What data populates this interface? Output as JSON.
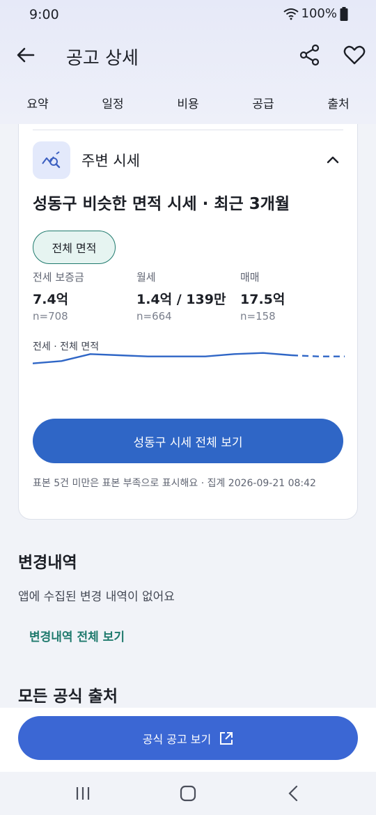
{
  "status_bar": {
    "time": "9:00",
    "battery": "100%"
  },
  "header": {
    "title": "공고 상세"
  },
  "tabs": [
    {
      "label": "요약"
    },
    {
      "label": "일정"
    },
    {
      "label": "비용"
    },
    {
      "label": "공급"
    },
    {
      "label": "출처"
    }
  ],
  "market_card": {
    "heading": "주변 시세",
    "subtitle": "성동구 비슷한 면적 시세 · 최근 3개월",
    "filter_chip": "전체 면적",
    "stats": [
      {
        "label": "전세 보증금",
        "value": "7.4억",
        "n": "n=708"
      },
      {
        "label": "월세",
        "value": "1.4억 / 139만",
        "n": "n=664"
      },
      {
        "label": "매매",
        "value": "17.5억",
        "n": "n=158"
      }
    ],
    "chart_label": "전세 · 전체 면적",
    "view_all_button": "성동구 시세 전체 보기",
    "footnote": "표본 5건 미만은 표본 부족으로 표시해요 · 집계 2026-09-21 08:42",
    "colors": {
      "accent": "#2f66c6",
      "chip_border": "#1f7a6d"
    }
  },
  "chart_data": {
    "type": "line",
    "title": "전세 · 전체 면적",
    "series": [
      {
        "values": [
          0.2,
          0.4,
          1.0,
          0.9,
          0.8,
          0.8,
          0.8,
          1.0,
          1.1,
          0.9
        ],
        "style": "solid"
      },
      {
        "values": [
          0.9,
          0.8,
          0.8
        ],
        "style": "dashed"
      }
    ]
  },
  "changes": {
    "title": "변경내역",
    "empty_text": "앱에 수집된 변경 내역이 없어요",
    "link": "변경내역 전체 보기"
  },
  "sources": {
    "title": "모든 공식 출처"
  },
  "bottom": {
    "official_button": "공식 공고 보기"
  },
  "icons": {
    "back": "arrow-left-icon",
    "share": "share-icon",
    "favorite": "heart-icon",
    "trend": "trend-search-icon",
    "collapse": "chevron-up-icon",
    "external": "external-link-icon"
  }
}
